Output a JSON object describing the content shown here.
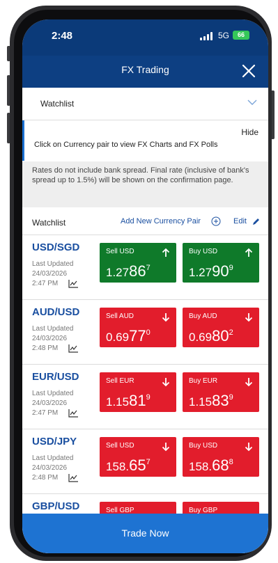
{
  "status": {
    "time": "2:48",
    "network": "5G",
    "battery": "66"
  },
  "header": {
    "title": "FX Trading"
  },
  "selector": {
    "label": "Watchlist"
  },
  "info": {
    "hide": "Hide",
    "message": "Click on Currency pair to view FX Charts and FX Polls"
  },
  "notice": "Rates do not include bank spread. Final rate (inclusive of bank's spread up to 1.5%) will be shown on the confirmation page.",
  "watchlist": {
    "title": "Watchlist",
    "add_label": "Add New Currency Pair",
    "edit_label": "Edit",
    "last_updated_label": "Last Updated",
    "pairs": [
      {
        "pair": "USD/SGD",
        "date": "24/03/2026",
        "time": "2:47 PM",
        "sell": {
          "label": "Sell USD",
          "prefix": "1.27",
          "big": "86",
          "sup": "7"
        },
        "buy": {
          "label": "Buy USD",
          "prefix": "1.27",
          "big": "90",
          "sup": "9"
        }
      },
      {
        "pair": "AUD/USD",
        "date": "24/03/2026",
        "time": "2:48 PM",
        "sell": {
          "label": "Sell AUD",
          "prefix": "0.69",
          "big": "77",
          "sup": "0"
        },
        "buy": {
          "label": "Buy AUD",
          "prefix": "0.69",
          "big": "80",
          "sup": "2"
        }
      },
      {
        "pair": "EUR/USD",
        "date": "24/03/2026",
        "time": "2:47 PM",
        "sell": {
          "label": "Sell EUR",
          "prefix": "1.15",
          "big": "81",
          "sup": "9"
        },
        "buy": {
          "label": "Buy EUR",
          "prefix": "1.15",
          "big": "83",
          "sup": "9"
        }
      },
      {
        "pair": "USD/JPY",
        "date": "24/03/2026",
        "time": "2:48 PM",
        "sell": {
          "label": "Sell USD",
          "prefix": "158.",
          "big": "65",
          "sup": "7"
        },
        "buy": {
          "label": "Buy USD",
          "prefix": "158.",
          "big": "68",
          "sup": "8"
        }
      },
      {
        "pair": "GBP/USD",
        "sell": {
          "label": "Sell GBP"
        },
        "buy": {
          "label": "Buy GBP"
        }
      }
    ]
  },
  "footer": {
    "trade_label": "Trade Now"
  },
  "colors": {
    "navy": "#0d3f82",
    "up_green": "#0f7a2a",
    "down_red": "#e21d2c",
    "accent_blue": "#1e73d2"
  }
}
